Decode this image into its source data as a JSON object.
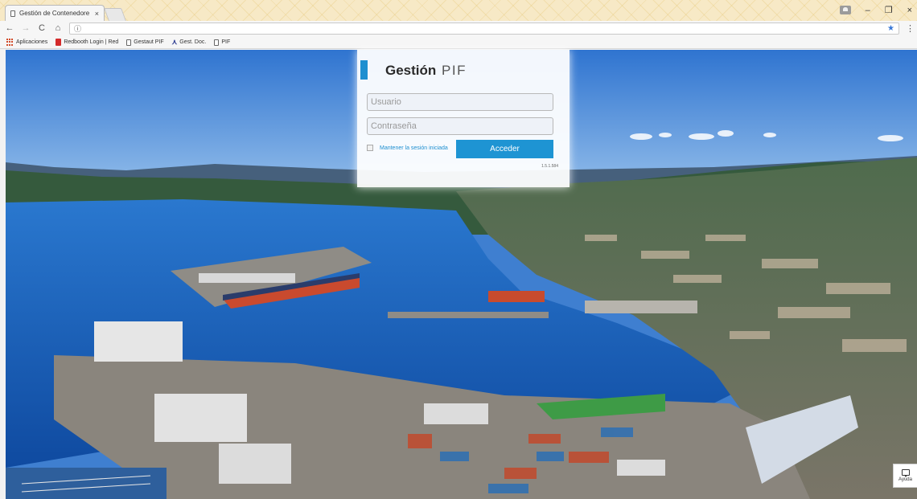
{
  "browser": {
    "tab_title": "Gestión de Contenedore",
    "tab_close": "×",
    "win_minimize": "–",
    "win_maximize": "❐",
    "win_close": "×",
    "address_icon": "ⓘ",
    "bookmarks": [
      {
        "label": "Aplicaciones",
        "icon": "apps-grid-icon"
      },
      {
        "label": "Redbooth Login | Red",
        "icon": "redbooth-icon"
      },
      {
        "label": "Gestaut PIF",
        "icon": "page-icon"
      },
      {
        "label": "Gest. Doc.",
        "icon": "chevron-logo-icon"
      },
      {
        "label": "PIF",
        "icon": "page-icon"
      }
    ]
  },
  "login": {
    "brand_main": "Gestión",
    "brand_sub": "PIF",
    "user_placeholder": "Usuario",
    "pass_placeholder": "Contraseña",
    "remember_label": "Mantener la sesión iniciada",
    "submit_label": "Acceder",
    "version": "1.5.1.584"
  },
  "help": {
    "label": "Ayuda"
  },
  "colors": {
    "accent": "#1e94d3",
    "sky": "#3f7fd0",
    "water": "#1a5eb5"
  }
}
